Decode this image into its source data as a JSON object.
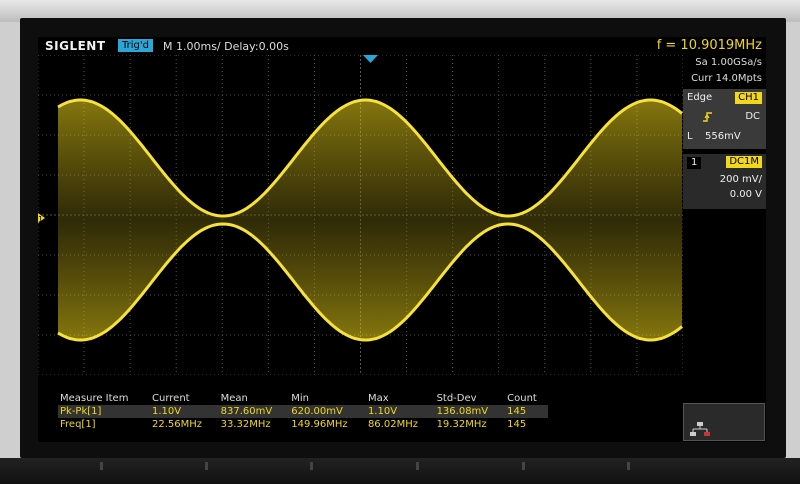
{
  "brand": "SIGLENT",
  "status": {
    "trig_state": "Trig'd",
    "timebase": "M 1.00ms/ Delay:0.00s",
    "frequency": "f = 10.9019MHz"
  },
  "acquisition": {
    "sample_rate": "Sa 1.00GSa/s",
    "memory": "Curr 14.0Mpts"
  },
  "trigger": {
    "type": "Edge",
    "source": "CH1",
    "slope_icon": "rising-edge-icon",
    "coupling": "DC",
    "level_label": "L",
    "level": "556mV"
  },
  "channel": {
    "number": "1",
    "coupling": "DC1M",
    "scale": "200 mV/",
    "offset": "0.00 V"
  },
  "measure": {
    "headers": [
      "Measure Item",
      "Current",
      "Mean",
      "Min",
      "Max",
      "Std-Dev",
      "Count"
    ],
    "rows": [
      [
        "Pk-Pk[1]",
        "1.10V",
        "837.60mV",
        "620.00mV",
        "1.10V",
        "136.08mV",
        "145"
      ],
      [
        "Freq[1]",
        "22.56MHz",
        "33.32MHz",
        "149.96MHz",
        "86.02MHz",
        "19.32MHz",
        "145"
      ]
    ]
  },
  "markers": {
    "channel_marker": "1"
  },
  "colors": {
    "trace": "#f2d81a",
    "trig_badge": "#2aa7d8",
    "grid": "#555555"
  }
}
